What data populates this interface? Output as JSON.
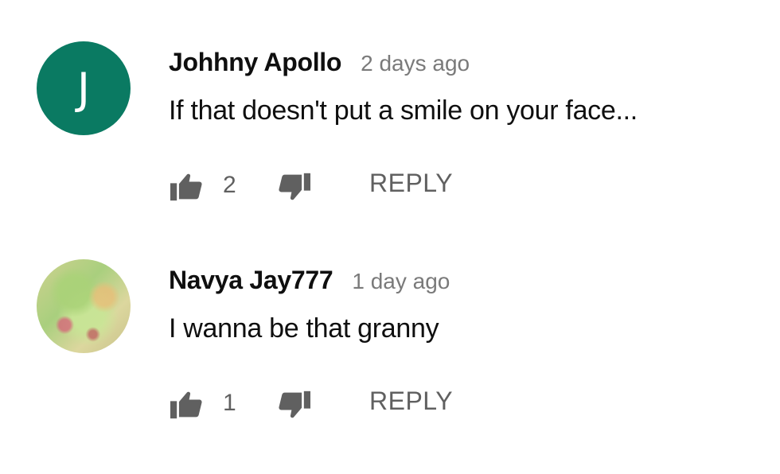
{
  "comments": [
    {
      "author": "Johhny Apollo",
      "time": "2 days ago",
      "text": "If that doesn't put a smile on your face...",
      "likes": "2",
      "reply_label": "REPLY",
      "avatar": {
        "type": "letter",
        "letter": "J",
        "color": "#0a7a62"
      }
    },
    {
      "author": "Navya Jay777",
      "time": "1 day ago",
      "text": "I wanna be that granny",
      "likes": "1",
      "reply_label": "REPLY",
      "avatar": {
        "type": "photo"
      }
    }
  ],
  "icons": {
    "like": "thumbs-up-icon",
    "dislike": "thumbs-down-icon"
  },
  "colors": {
    "primary_text": "#0f0f0f",
    "secondary_text": "#606060",
    "timestamp": "#7a7a7a"
  }
}
